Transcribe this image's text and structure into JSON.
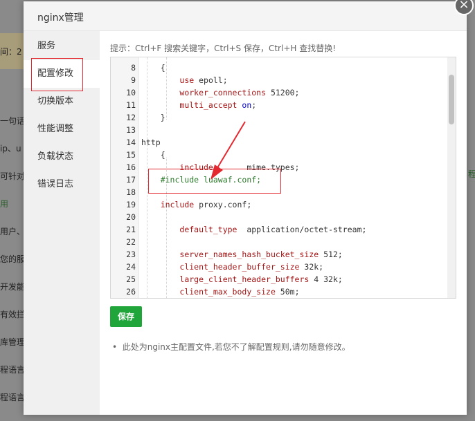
{
  "background": {
    "texts": [
      "间：2",
      "一句话术",
      "ip、u",
      "可针对攻",
      "用",
      "用户、",
      "您的服务",
      "开发能力",
      "有效拦",
      "库管理",
      "程语言",
      "程语言"
    ],
    "right_text": "程"
  },
  "dialog": {
    "title": "nginx管理",
    "close_label": "×",
    "sidebar": [
      {
        "label": "服务"
      },
      {
        "label": "配置修改"
      },
      {
        "label": "切换版本"
      },
      {
        "label": "性能调整"
      },
      {
        "label": "负载状态"
      },
      {
        "label": "错误日志"
      }
    ],
    "hint": "提示：Ctrl+F 搜索关键字，Ctrl+S 保存，Ctrl+H 查找替换!",
    "editor": {
      "lines": [
        {
          "n": "8",
          "code": "    {"
        },
        {
          "n": "9",
          "code": "        use epoll;"
        },
        {
          "n": "10",
          "code": "        worker_connections 51200;"
        },
        {
          "n": "11",
          "code": "        multi_accept on;"
        },
        {
          "n": "12",
          "code": "    }"
        },
        {
          "n": "13",
          "code": ""
        },
        {
          "n": "14",
          "code": "http"
        },
        {
          "n": "15",
          "code": "    {"
        },
        {
          "n": "16",
          "code": "        include       mime.types;"
        },
        {
          "n": "17",
          "code": "    #include luawaf.conf;"
        },
        {
          "n": "18",
          "code": ""
        },
        {
          "n": "19",
          "code": "    include proxy.conf;"
        },
        {
          "n": "20",
          "code": ""
        },
        {
          "n": "21",
          "code": "        default_type  application/octet-stream;"
        },
        {
          "n": "22",
          "code": ""
        },
        {
          "n": "23",
          "code": "        server_names_hash_bucket_size 512;"
        },
        {
          "n": "24",
          "code": "        client_header_buffer_size 32k;"
        },
        {
          "n": "25",
          "code": "        large_client_header_buffers 4 32k;"
        },
        {
          "n": "26",
          "code": "        client_max_body_size 50m;"
        }
      ]
    },
    "save_label": "保存",
    "note": "此处为nginx主配置文件,若您不了解配置规则,请勿随意修改。"
  }
}
